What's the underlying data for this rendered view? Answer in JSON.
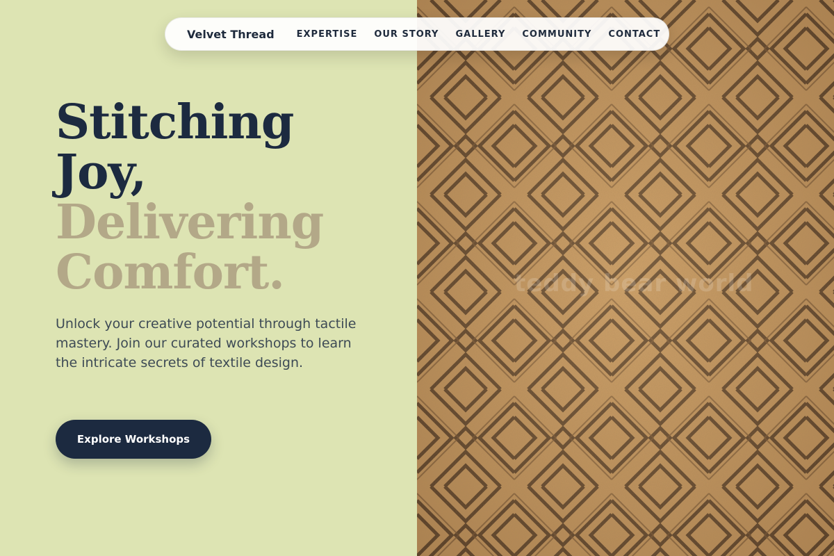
{
  "nav": {
    "brand": "Velvet Thread",
    "links": [
      "EXPERTISE",
      "OUR STORY",
      "GALLERY",
      "COMMUNITY",
      "CONTACT"
    ]
  },
  "hero": {
    "headline_line1": "Stitching",
    "headline_line2": "Joy,",
    "headline_line3": "Delivering",
    "headline_line4": "Comfort.",
    "description": "Unlock your creative potential through tactile mastery. Join our curated workshops to learn the intricate secrets of textile design.",
    "cta_label": "Explore Workshops"
  },
  "image": {
    "watermark": "teddy bear world"
  },
  "colors": {
    "background": "#dde4b3",
    "navy": "#1c2a40",
    "muted_headline": "#b3a888",
    "fabric": "#c6955c",
    "fabric_lines": "#4a3320"
  }
}
